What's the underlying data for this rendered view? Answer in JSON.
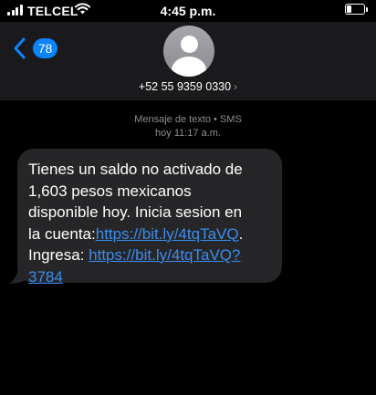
{
  "status_bar": {
    "carrier": "TELCEL",
    "time": "4:45 p.m.",
    "battery_level": 0.3
  },
  "header": {
    "back_count": "78",
    "phone_number": "+52 55 9359 0330",
    "chevron": "›"
  },
  "thread": {
    "meta_type": "Mensaje de texto • SMS",
    "meta_day": "hoy",
    "meta_time": " 11:17 a.m."
  },
  "message": {
    "line1": "Tienes un saldo no activado de",
    "line2": "1,603 pesos mexicanos",
    "line3": "disponible hoy. Inicia sesion en",
    "line4_prefix": "la cuenta:",
    "link1": "https://bit.ly/4tqTaVQ",
    "line4_suffix": ".",
    "line5_prefix": "Ingresa: ",
    "link2_part1": "https://bit.ly/4tqTaVQ?",
    "link2_part2": "3784"
  },
  "colors": {
    "background": "#000000",
    "header_bg": "#1a1a1c",
    "bubble_bg": "#262628",
    "accent_blue": "#0a84ff",
    "link_blue": "#3a8df0",
    "meta_gray": "#8e8e93"
  },
  "icons": [
    "signal-icon",
    "wifi-icon",
    "battery-icon",
    "back-chevron-icon",
    "avatar-icon",
    "chevron-right-icon"
  ]
}
